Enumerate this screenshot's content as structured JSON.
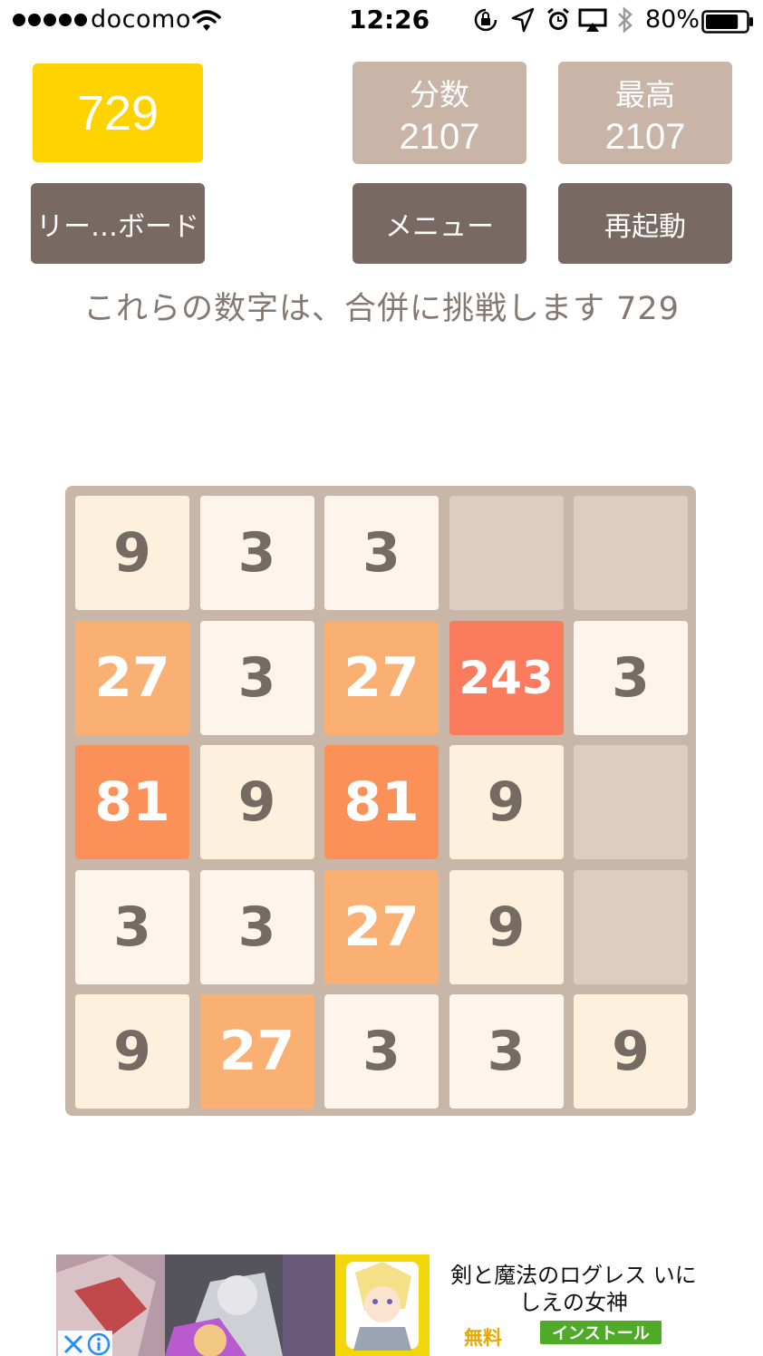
{
  "status_bar": {
    "carrier": "docomo",
    "time": "12:26",
    "battery_percent": "80%",
    "signal_bars": 5,
    "battery_level": 0.8
  },
  "header": {
    "target_tile": "729",
    "score": {
      "label": "分数",
      "value": "2107"
    },
    "best": {
      "label": "最高",
      "value": "2107"
    },
    "leaderboard_button": "リー…ボード",
    "menu_button": "メニュー",
    "restart_button": "再起動"
  },
  "subtitle": "これらの数字は、合併に挑戦します 729",
  "board": {
    "rows": [
      [
        "9",
        "3",
        "3",
        "",
        ""
      ],
      [
        "27",
        "3",
        "27",
        "243",
        "3"
      ],
      [
        "81",
        "9",
        "81",
        "9",
        ""
      ],
      [
        "3",
        "3",
        "27",
        "9",
        ""
      ],
      [
        "9",
        "27",
        "3",
        "3",
        "9"
      ]
    ]
  },
  "tile_colors": {
    "empty": "#dccdc0",
    "3": "#fdf4ec",
    "9": "#fdf0dc",
    "27": "#fab072",
    "81": "#fb9159",
    "243": "#fb7b5d"
  },
  "text_colors": {
    "dark": "#766b63",
    "light": "#ffffff"
  },
  "colors": {
    "target": "#ffd300",
    "score_box": "#c9b5a8",
    "button": "#786a62",
    "board": "#c8b6a8"
  },
  "ad": {
    "title": "剣と魔法のログレス いにしえの女神",
    "price": "無料",
    "install_button": "インストール",
    "close_icon": "close-icon",
    "info_icon": "info-icon"
  }
}
